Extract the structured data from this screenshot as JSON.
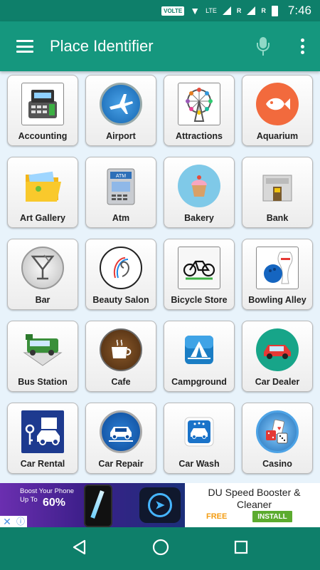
{
  "status_bar": {
    "network_label": "VOLTE",
    "roaming_1": "R",
    "roaming_2": "R",
    "lte": "LTE",
    "time": "7:46"
  },
  "app_bar": {
    "title": "Place Identifier"
  },
  "places": [
    {
      "label": "Accounting",
      "icon": "accounting-machine-icon"
    },
    {
      "label": "Airport",
      "icon": "airplane-icon"
    },
    {
      "label": "Attractions",
      "icon": "ferris-wheel-icon"
    },
    {
      "label": "Aquarium",
      "icon": "fish-icon"
    },
    {
      "label": "Art Gallery",
      "icon": "folder-art-icon"
    },
    {
      "label": "Atm",
      "icon": "atm-machine-icon"
    },
    {
      "label": "Bakery",
      "icon": "cupcake-icon"
    },
    {
      "label": "Bank",
      "icon": "bank-building-icon"
    },
    {
      "label": "Bar",
      "icon": "cocktail-glass-icon"
    },
    {
      "label": "Beauty Salon",
      "icon": "hair-salon-icon"
    },
    {
      "label": "Bicycle Store",
      "icon": "bicycle-icon"
    },
    {
      "label": "Bowling Alley",
      "icon": "bowling-icon"
    },
    {
      "label": "Bus Station",
      "icon": "bus-icon"
    },
    {
      "label": "Cafe",
      "icon": "coffee-cup-icon"
    },
    {
      "label": "Campground",
      "icon": "tent-icon"
    },
    {
      "label": "Car Dealer",
      "icon": "red-car-icon"
    },
    {
      "label": "Car Rental",
      "icon": "car-key-icon"
    },
    {
      "label": "Car Repair",
      "icon": "car-repair-icon"
    },
    {
      "label": "Car Wash",
      "icon": "car-wash-icon"
    },
    {
      "label": "Casino",
      "icon": "casino-icon"
    }
  ],
  "ad": {
    "boost_text": "Boost Your Phone",
    "boost_up_to": "Up To",
    "boost_pct": "60%",
    "title": "DU Speed Booster & Cleaner",
    "free": "FREE",
    "install": "INSTALL",
    "close_glyph": "✕",
    "info_glyph": "ⓘ"
  },
  "colors": {
    "status_bar": "#0e7f6a",
    "app_bar": "#15977e",
    "background": "#e8f3fb"
  }
}
